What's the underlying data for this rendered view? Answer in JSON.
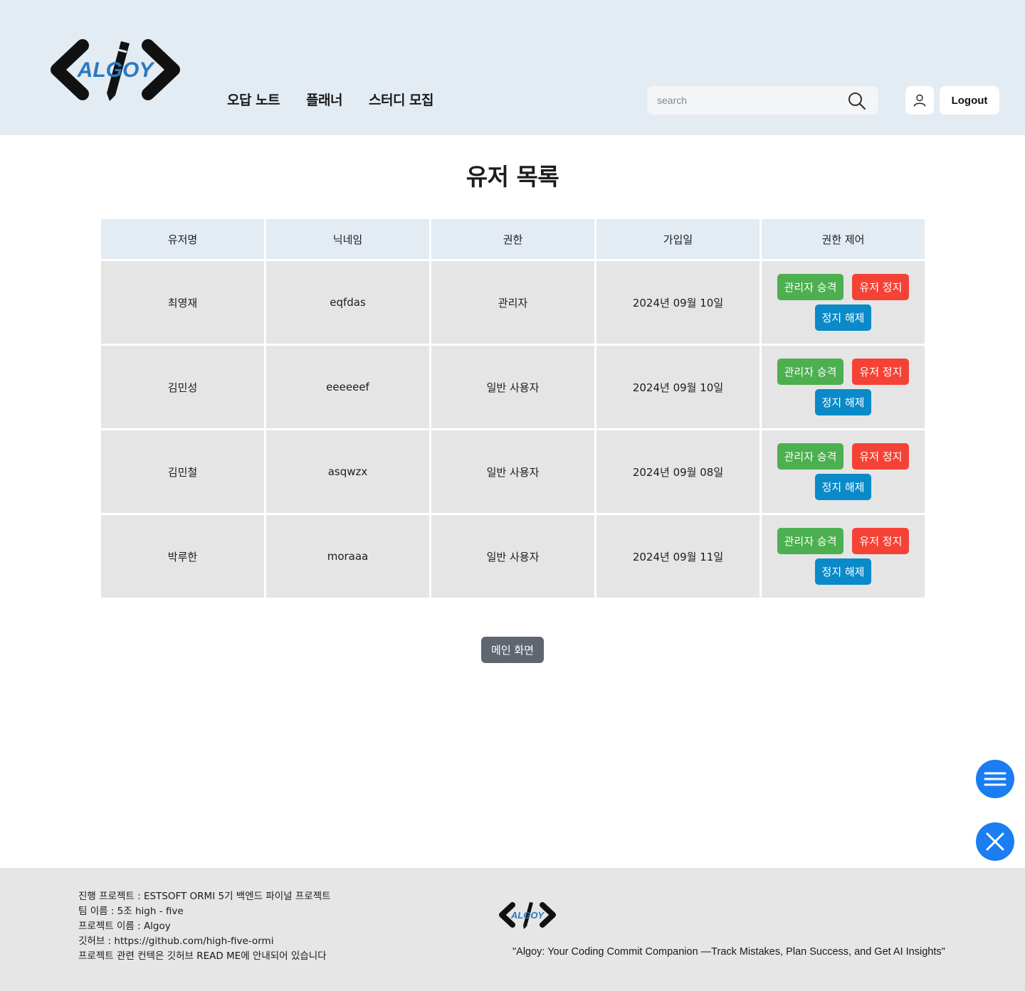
{
  "header": {
    "logo_text": "ALGOY",
    "nav": [
      {
        "label": "오답 노트"
      },
      {
        "label": "플래너"
      },
      {
        "label": "스터디 모집"
      }
    ],
    "search_placeholder": "search",
    "logout_label": "Logout"
  },
  "page": {
    "title": "유저 목록",
    "columns": [
      "유저명",
      "닉네임",
      "권한",
      "가입일",
      "권한 제어"
    ],
    "rows": [
      {
        "name": "최영재",
        "nickname": "eqfdas",
        "role": "관리자",
        "joined": "2024년 09월 10일"
      },
      {
        "name": "김민성",
        "nickname": "eeeeeef",
        "role": "일반 사용자",
        "joined": "2024년 09월 10일"
      },
      {
        "name": "김민철",
        "nickname": "asqwzx",
        "role": "일반 사용자",
        "joined": "2024년 09월 08일"
      },
      {
        "name": "박루한",
        "nickname": "moraaa",
        "role": "일반 사용자",
        "joined": "2024년 09월 11일"
      }
    ],
    "actions": {
      "promote": "관리자 승격",
      "suspend": "유저 정지",
      "unsuspend": "정지 해제"
    },
    "main_button": "메인 화면"
  },
  "footer": {
    "lines": [
      "진행 프로젝트 : ESTSOFT ORMI 5기 백엔드 파이널 프로젝트",
      "팀 이름 : 5조 high - five",
      "프로젝트 이름 : Algoy",
      "깃허브 : https://github.com/high-five-ormi",
      "프로젝트 관련 컨텍은 깃허브 READ ME에 안내되어 있습니다"
    ],
    "logo_text": "ALGOY",
    "tagline": "\"Algoy: Your Coding Commit Companion —Track Mistakes, Plan Success, and Get AI Insights\""
  },
  "colors": {
    "header_bg": "#e3ebf3",
    "promote": "#4caf50",
    "suspend": "#f44336",
    "unsuspend": "#0a8ac8",
    "fab": "#1a7df2",
    "footer_bg": "#e6e6e6"
  },
  "icons": [
    "search-icon",
    "user-icon",
    "hamburger-menu-icon",
    "close-icon",
    "pencil-icon"
  ]
}
